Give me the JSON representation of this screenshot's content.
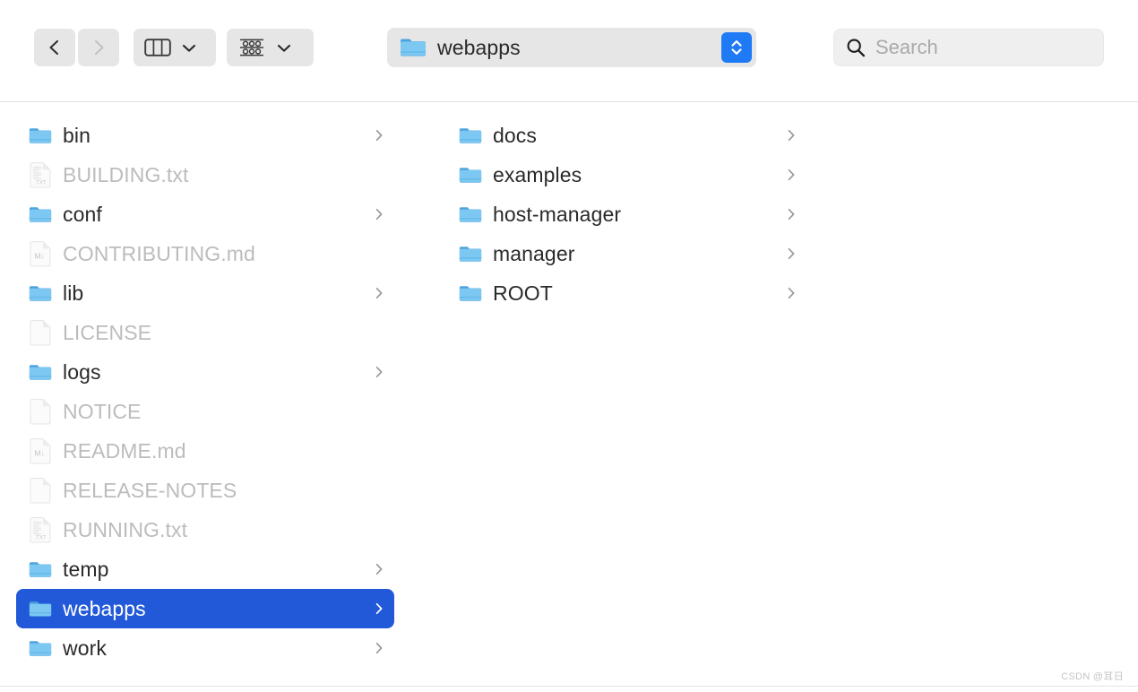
{
  "window": {
    "title": "webapps"
  },
  "toolbar": {
    "back_label": "Back",
    "back_icon": "chevron-left-icon",
    "back_enabled": true,
    "forward_label": "Forward",
    "forward_icon": "chevron-right-icon",
    "forward_enabled": false,
    "view_mode": "column",
    "view_icon": "column-view-icon",
    "view_caret_icon": "chevron-down-icon",
    "group_label": "Group",
    "group_icon": "group-items-icon",
    "group_caret_icon": "chevron-down-icon",
    "path": {
      "label": "webapps",
      "icon": "folder-icon",
      "stepper_icon": "updown-chevron-icon"
    },
    "search": {
      "placeholder": "Search",
      "value": "",
      "icon": "search-icon"
    }
  },
  "columns": [
    {
      "name": "column-1",
      "items": [
        {
          "label": "bin",
          "kind": "folder",
          "icon": "folder-icon",
          "disclosure": true,
          "dim": false,
          "selected": false
        },
        {
          "label": "BUILDING.txt",
          "kind": "txt",
          "icon": "txt-file-icon",
          "disclosure": false,
          "dim": true,
          "selected": false
        },
        {
          "label": "conf",
          "kind": "folder",
          "icon": "folder-icon",
          "disclosure": true,
          "dim": false,
          "selected": false
        },
        {
          "label": "CONTRIBUTING.md",
          "kind": "md",
          "icon": "md-file-icon",
          "disclosure": false,
          "dim": true,
          "selected": false
        },
        {
          "label": "lib",
          "kind": "folder",
          "icon": "folder-icon",
          "disclosure": true,
          "dim": false,
          "selected": false
        },
        {
          "label": "LICENSE",
          "kind": "plain",
          "icon": "blank-file-icon",
          "disclosure": false,
          "dim": true,
          "selected": false
        },
        {
          "label": "logs",
          "kind": "folder",
          "icon": "folder-icon",
          "disclosure": true,
          "dim": false,
          "selected": false
        },
        {
          "label": "NOTICE",
          "kind": "plain",
          "icon": "blank-file-icon",
          "disclosure": false,
          "dim": true,
          "selected": false
        },
        {
          "label": "README.md",
          "kind": "md",
          "icon": "md-file-icon",
          "disclosure": false,
          "dim": true,
          "selected": false
        },
        {
          "label": "RELEASE-NOTES",
          "kind": "plain",
          "icon": "blank-file-icon",
          "disclosure": false,
          "dim": true,
          "selected": false
        },
        {
          "label": "RUNNING.txt",
          "kind": "txt",
          "icon": "txt-file-icon",
          "disclosure": false,
          "dim": true,
          "selected": false
        },
        {
          "label": "temp",
          "kind": "folder",
          "icon": "folder-icon",
          "disclosure": true,
          "dim": false,
          "selected": false
        },
        {
          "label": "webapps",
          "kind": "folder",
          "icon": "folder-icon",
          "disclosure": true,
          "dim": false,
          "selected": true
        },
        {
          "label": "work",
          "kind": "folder",
          "icon": "folder-icon",
          "disclosure": true,
          "dim": false,
          "selected": false
        }
      ]
    },
    {
      "name": "column-2",
      "items": [
        {
          "label": "docs",
          "kind": "folder",
          "icon": "folder-icon",
          "disclosure": true,
          "dim": false,
          "selected": false
        },
        {
          "label": "examples",
          "kind": "folder",
          "icon": "folder-icon",
          "disclosure": true,
          "dim": false,
          "selected": false
        },
        {
          "label": "host-manager",
          "kind": "folder",
          "icon": "folder-icon",
          "disclosure": true,
          "dim": false,
          "selected": false
        },
        {
          "label": "manager",
          "kind": "folder",
          "icon": "folder-icon",
          "disclosure": true,
          "dim": false,
          "selected": false
        },
        {
          "label": "ROOT",
          "kind": "folder",
          "icon": "folder-icon",
          "disclosure": true,
          "dim": false,
          "selected": false
        }
      ]
    },
    {
      "name": "column-3",
      "items": []
    }
  ],
  "watermark": "CSDN @耳日",
  "colors": {
    "selection": "#2159d8",
    "folder": "#6bbdf0",
    "accent": "#1f7af5",
    "dim_text": "#bcbcbc",
    "text": "#2a2a2a"
  }
}
